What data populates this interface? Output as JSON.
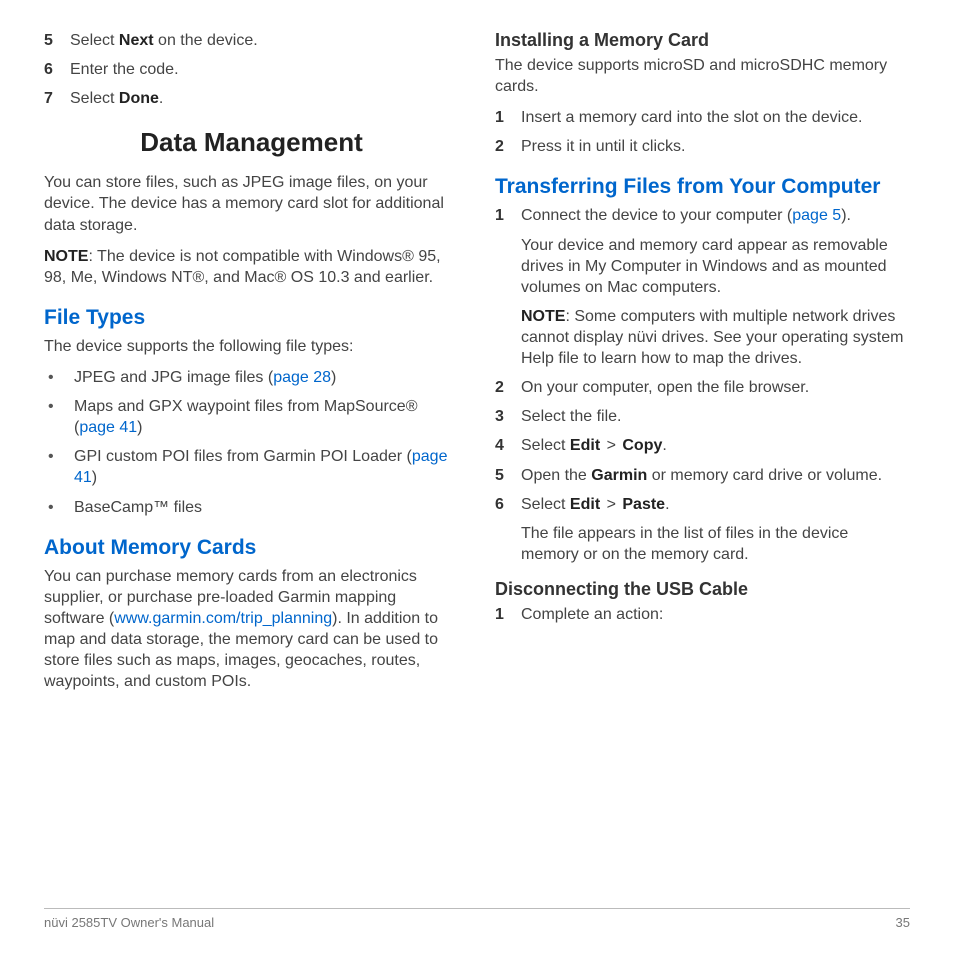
{
  "left": {
    "top_steps": [
      {
        "num": "5",
        "pre": "Select ",
        "bold": "Next",
        "post": " on the device."
      },
      {
        "num": "6",
        "pre": "Enter the code.",
        "bold": "",
        "post": ""
      },
      {
        "num": "7",
        "pre": "Select ",
        "bold": "Done",
        "post": "."
      }
    ],
    "h1": "Data Management",
    "intro": "You can store files, such as JPEG image files, on your device. The device has a memory card slot for additional data storage.",
    "note_label": "NOTE",
    "note_text": ": The device is not compatible with Windows® 95, 98, Me, Windows NT®, and Mac® OS 10.3 and earlier.",
    "h2_filetypes": "File Types",
    "filetypes_intro": "The device supports the following file types:",
    "filetypes": [
      {
        "pre": "JPEG and JPG image files (",
        "link": "page 28",
        "post": ")"
      },
      {
        "pre": "Maps and GPX waypoint files from MapSource® (",
        "link": "page 41",
        "post": ")"
      },
      {
        "pre": "GPI custom POI files from Garmin POI Loader (",
        "link": "page 41",
        "post": ")"
      },
      {
        "pre": "BaseCamp™ files",
        "link": "",
        "post": ""
      }
    ],
    "h2_memcards": "About Memory Cards",
    "memcards_pre": "You can purchase memory cards from an electronics supplier, or purchase pre-loaded Garmin mapping software (",
    "memcards_link": "www.garmin.com/trip_planning",
    "memcards_post": "). In addition to map and data storage, the memory card can be used to store files such as maps, images, geocaches, routes, waypoints, and custom POIs."
  },
  "right": {
    "h3_install": "Installing a Memory Card",
    "install_intro": "The device supports microSD and microSDHC memory cards.",
    "install_steps": [
      {
        "num": "1",
        "text": "Insert a memory card into the slot on the device."
      },
      {
        "num": "2",
        "text": "Press it in until it clicks."
      }
    ],
    "h2_transfer": "Transferring Files from Your Computer",
    "step1_num": "1",
    "step1_pre": "Connect the device to your computer (",
    "step1_link": "page 5",
    "step1_post": ").",
    "step1_sub1": "Your device and memory card appear as removable drives in My Computer in Windows and as mounted volumes on Mac computers.",
    "step1_note_label": "NOTE",
    "step1_note_text": ": Some computers with multiple network drives cannot display nüvi drives. See your operating system Help file to learn how to map the drives.",
    "step2_num": "2",
    "step2_text": "On your computer, open the file browser.",
    "step3_num": "3",
    "step3_text": "Select the file.",
    "step4_num": "4",
    "step4_pre": "Select ",
    "step4_b1": "Edit",
    "step4_gt": " > ",
    "step4_b2": "Copy",
    "step4_post": ".",
    "step5_num": "5",
    "step5_pre": "Open the ",
    "step5_b": "Garmin",
    "step5_post": " or memory card drive or volume.",
    "step6_num": "6",
    "step6_pre": "Select ",
    "step6_b1": "Edit",
    "step6_gt": " > ",
    "step6_b2": "Paste",
    "step6_post": ".",
    "step6_sub": "The file appears in the list of files in the device memory or on the memory card.",
    "h3_disconnect": "Disconnecting the USB Cable",
    "disconnect_step_num": "1",
    "disconnect_step_text": "Complete an action:"
  },
  "footer": {
    "left": "nüvi 2585TV Owner's Manual",
    "right": "35"
  }
}
